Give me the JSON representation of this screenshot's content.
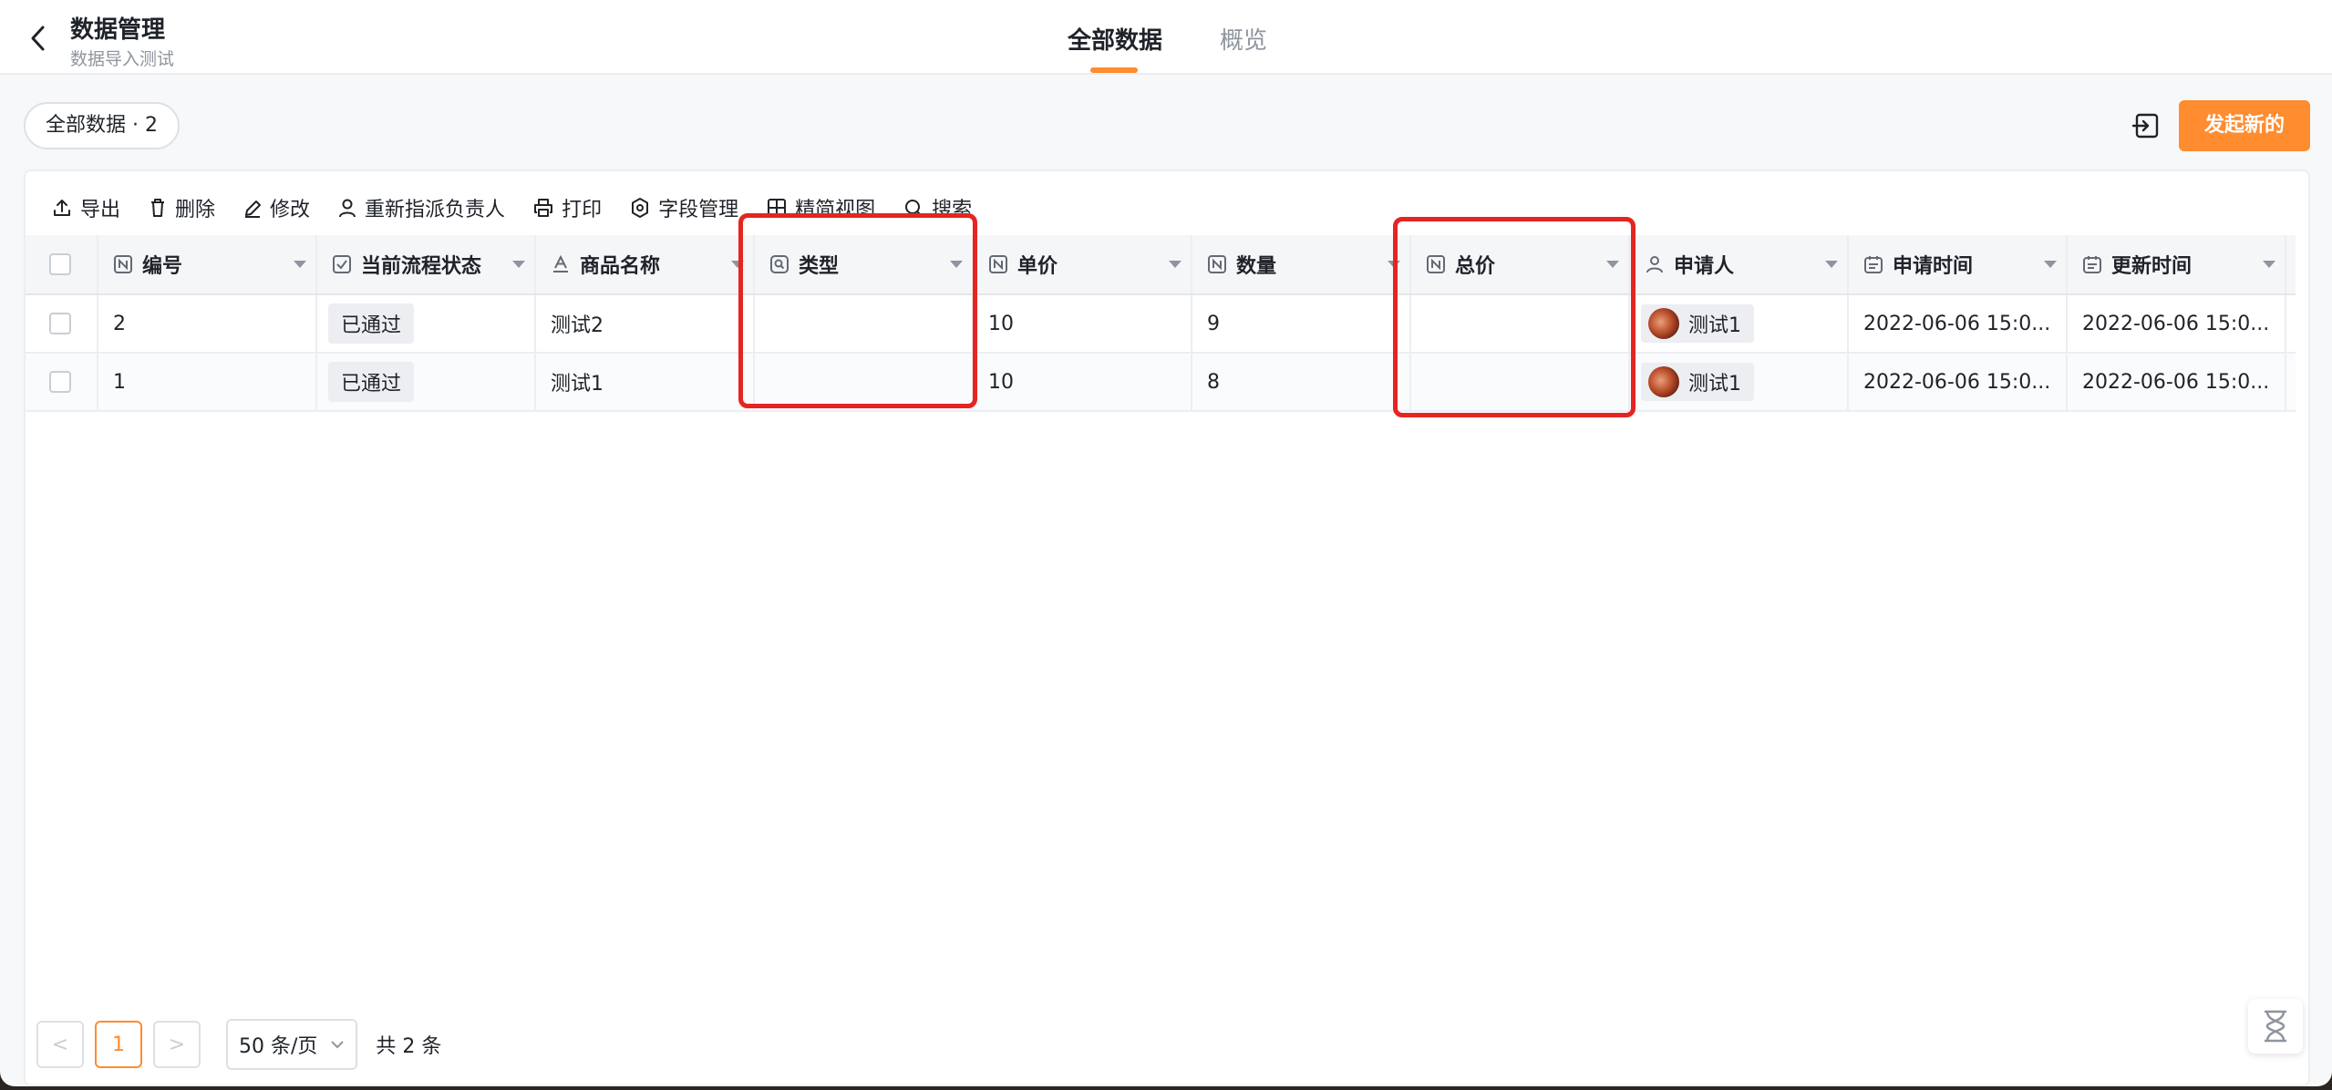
{
  "header": {
    "title": "数据管理",
    "subtitle": "数据导入测试",
    "tabs": [
      {
        "label": "全部数据",
        "active": true
      },
      {
        "label": "概览",
        "active": false
      }
    ]
  },
  "subbar": {
    "view_chip": "全部数据 · 2",
    "primary_button": "发起新的"
  },
  "toolbar": {
    "items": [
      {
        "label": "导出",
        "icon": "upload-icon"
      },
      {
        "label": "删除",
        "icon": "trash-icon"
      },
      {
        "label": "修改",
        "icon": "edit-icon"
      },
      {
        "label": "重新指派负责人",
        "icon": "user-icon"
      },
      {
        "label": "打印",
        "icon": "printer-icon"
      },
      {
        "label": "字段管理",
        "icon": "gear-icon"
      },
      {
        "label": "精简视图",
        "icon": "grid-icon"
      },
      {
        "label": "搜索",
        "icon": "search-icon"
      }
    ]
  },
  "table": {
    "columns": [
      {
        "label": "编号",
        "icon": "number-field-icon"
      },
      {
        "label": "当前流程状态",
        "icon": "checkbox-field-icon"
      },
      {
        "label": "商品名称",
        "icon": "text-field-icon"
      },
      {
        "label": "类型",
        "icon": "lookup-field-icon"
      },
      {
        "label": "单价",
        "icon": "number-field-icon"
      },
      {
        "label": "数量",
        "icon": "number-field-icon"
      },
      {
        "label": "总价",
        "icon": "number-field-icon"
      },
      {
        "label": "申请人",
        "icon": "person-field-icon"
      },
      {
        "label": "申请时间",
        "icon": "date-field-icon"
      },
      {
        "label": "更新时间",
        "icon": "date-field-icon"
      }
    ],
    "rows": [
      {
        "id": "2",
        "status": "已通过",
        "name": "测试2",
        "type": "",
        "price": "10",
        "qty": "9",
        "total": "",
        "applicant": "测试1",
        "applied_at": "2022-06-06 15:0...",
        "updated_at": "2022-06-06 15:0..."
      },
      {
        "id": "1",
        "status": "已通过",
        "name": "测试1",
        "type": "",
        "price": "10",
        "qty": "8",
        "total": "",
        "applicant": "测试1",
        "applied_at": "2022-06-06 15:0...",
        "updated_at": "2022-06-06 15:0..."
      }
    ]
  },
  "pagination": {
    "prev": "<",
    "current_page": "1",
    "next": ">",
    "page_size": "50 条/页",
    "total": "共 2 条"
  },
  "colors": {
    "accent": "#ff8c2f",
    "highlight": "#e52521"
  }
}
